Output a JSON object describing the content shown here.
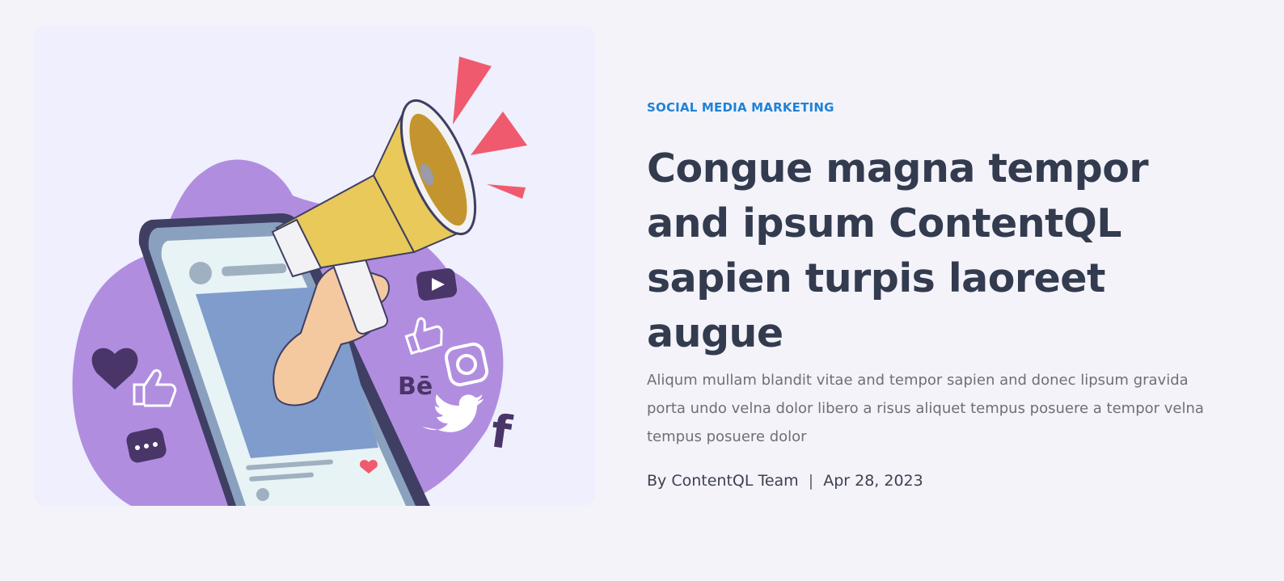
{
  "post": {
    "category": "SOCIAL MEDIA MARKETING",
    "title": "Congue magna tempor and ipsum ContentQL sapien turpis laoreet augue",
    "excerpt": "Aliqum mullam blandit vitae and tempor sapien and donec lipsum gravida porta undo velna dolor libero a risus aliquet tempus posuere a tempor velna tempus posuere dolor",
    "meta": {
      "by_prefix": "By",
      "author": "ContentQL Team",
      "separator": "|",
      "date": "Apr 28, 2023"
    }
  },
  "illustration": {
    "icons": [
      "heart-icon",
      "thumbs-up-icon",
      "chat-bubble-icon",
      "youtube-play-icon",
      "instagram-icon",
      "behance-icon",
      "twitter-bird-icon",
      "facebook-icon",
      "megaphone-icon",
      "smartphone-icon"
    ],
    "colors": {
      "blob": "#b18de0",
      "phone_frame": "#8aa0bf",
      "phone_screen": "#e8f3f6",
      "photo": "#7f9ccc",
      "megaphone": "#e8c95a",
      "accent_red": "#f05a6e",
      "icon_dark": "#4a3569"
    }
  },
  "colors": {
    "background": "#f4f3fa",
    "category": "#1f82d6",
    "title": "#333b4f",
    "excerpt": "#6e6f78",
    "meta": "#3c4152"
  }
}
